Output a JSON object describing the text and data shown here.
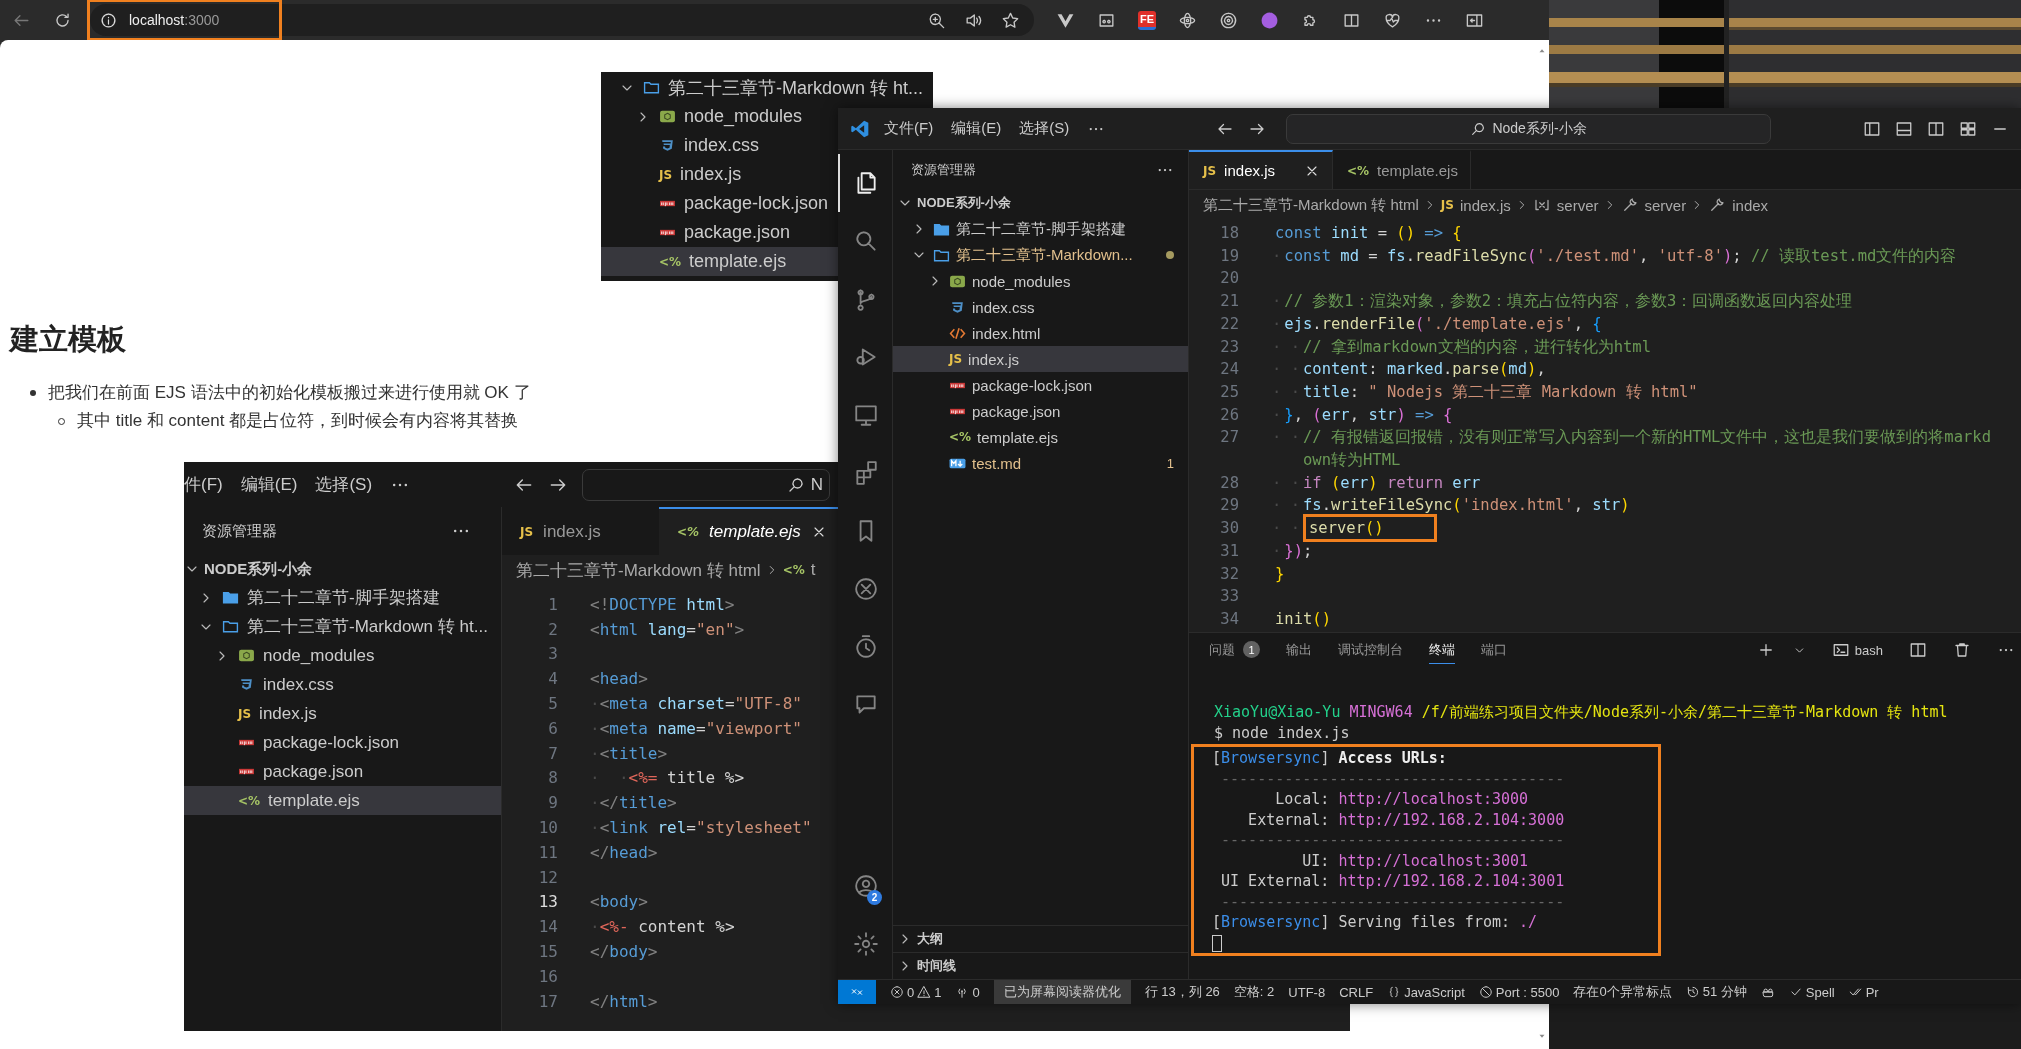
{
  "browser": {
    "address": {
      "host": "localhost",
      "port": ":3000",
      "highlighted": true
    },
    "fe_badge": "FE"
  },
  "page": {
    "explorer_shot": {
      "tree": [
        {
          "label": "第二十三章节-Markdown 转 ht...",
          "kind": "folder",
          "expanded": true,
          "selected": false,
          "children": [
            {
              "label": "node_modules",
              "kind": "node_modules",
              "expanded": false,
              "selected": false
            },
            {
              "label": "index.css",
              "kind": "css",
              "selected": false
            },
            {
              "label": "index.js",
              "kind": "js",
              "icon_text": "JS",
              "selected": false
            },
            {
              "label": "package-lock.json",
              "kind": "npm",
              "selected": false
            },
            {
              "label": "package.json",
              "kind": "npm",
              "selected": false
            },
            {
              "label": "template.ejs",
              "kind": "ejs",
              "icon_text": "<%",
              "selected": true
            }
          ]
        }
      ]
    },
    "heading": "建立模板",
    "bullets": [
      {
        "text": "把我们在前面 EJS 语法中的初始化模板搬过来进行使用就 OK 了",
        "children": [
          {
            "text": "其中 title 和 content 都是占位符，到时候会有内容将其替换"
          }
        ]
      }
    ],
    "editor_shot": {
      "menus": [
        "件(F)",
        "编辑(E)",
        "选择(S)"
      ],
      "search_text": "N",
      "explorer_title": "资源管理器",
      "root": "NODE系列-小余",
      "tree": [
        {
          "label": "第二十二章节-脚手架搭建",
          "kind": "folder",
          "expanded": false,
          "selected": false
        },
        {
          "label": "第二十三章节-Markdown 转 ht...",
          "kind": "folder",
          "expanded": true,
          "selected": false,
          "children": [
            {
              "label": "node_modules",
              "kind": "node_modules",
              "expanded": false,
              "selected": false
            },
            {
              "label": "index.css",
              "kind": "css",
              "selected": false
            },
            {
              "label": "index.js",
              "kind": "js",
              "icon_text": "JS",
              "selected": false
            },
            {
              "label": "package-lock.json",
              "kind": "npm",
              "selected": false
            },
            {
              "label": "package.json",
              "kind": "npm",
              "selected": false
            },
            {
              "label": "template.ejs",
              "kind": "ejs",
              "icon_text": "<%",
              "selected": true
            }
          ]
        }
      ],
      "tabs": [
        {
          "label": "index.js",
          "kind": "js",
          "icon_text": "JS",
          "selected": false,
          "preview": false
        },
        {
          "label": "template.ejs",
          "kind": "ejs",
          "icon_text": "<%",
          "selected": true,
          "preview": true
        }
      ],
      "breadcrumb": [
        {
          "label": "第二十三章节-Markdown 转 html",
          "kind": "plain"
        },
        {
          "label": "t",
          "kind": "ejs",
          "icon_text": "<%"
        }
      ],
      "lines": [
        {
          "n": "1",
          "current": false,
          "tokens": [
            {
              "kind": "tag",
              "text": "<!"
            },
            {
              "kind": "tagname",
              "text": "DOCTYPE "
            },
            {
              "kind": "attr",
              "text": "html"
            },
            {
              "kind": "tag",
              "text": ">"
            }
          ]
        },
        {
          "n": "2",
          "current": false,
          "tokens": [
            {
              "kind": "tag",
              "text": "<"
            },
            {
              "kind": "tagname",
              "text": "html "
            },
            {
              "kind": "attr",
              "text": "lang"
            },
            {
              "kind": "punct",
              "text": "="
            },
            {
              "kind": "string",
              "text": "\"en\""
            },
            {
              "kind": "tag",
              "text": ">"
            }
          ]
        },
        {
          "n": "3",
          "current": false
        },
        {
          "n": "4",
          "current": false,
          "tokens": [
            {
              "kind": "tag",
              "text": "<"
            },
            {
              "kind": "tagname",
              "text": "head"
            },
            {
              "kind": "tag",
              "text": ">"
            }
          ]
        },
        {
          "n": "5",
          "current": false,
          "indent": "·",
          "tokens": [
            {
              "kind": "tag",
              "text": "<"
            },
            {
              "kind": "tagname",
              "text": "meta "
            },
            {
              "kind": "attr",
              "text": "charset"
            },
            {
              "kind": "punct",
              "text": "="
            },
            {
              "kind": "string",
              "text": "\"UTF-8\""
            }
          ]
        },
        {
          "n": "6",
          "current": false,
          "indent": "·",
          "tokens": [
            {
              "kind": "tag",
              "text": "<"
            },
            {
              "kind": "tagname",
              "text": "meta "
            },
            {
              "kind": "attr",
              "text": "name"
            },
            {
              "kind": "punct",
              "text": "="
            },
            {
              "kind": "string",
              "text": "\"viewport\""
            }
          ]
        },
        {
          "n": "7",
          "current": false,
          "indent": "·",
          "tokens": [
            {
              "kind": "tag",
              "text": "<"
            },
            {
              "kind": "tagname",
              "text": "title"
            },
            {
              "kind": "tag",
              "text": ">"
            }
          ]
        },
        {
          "n": "8",
          "current": false,
          "indent": "·  ·",
          "tokens": [
            {
              "kind": "ejs",
              "text": "<%="
            },
            {
              "kind": "punct",
              "text": " title %>"
            }
          ]
        },
        {
          "n": "9",
          "current": false,
          "indent": "·",
          "tokens": [
            {
              "kind": "tag",
              "text": "</"
            },
            {
              "kind": "tagname",
              "text": "title"
            },
            {
              "kind": "tag",
              "text": ">"
            }
          ]
        },
        {
          "n": "10",
          "current": false,
          "indent": "·",
          "tokens": [
            {
              "kind": "tag",
              "text": "<"
            },
            {
              "kind": "tagname",
              "text": "link "
            },
            {
              "kind": "attr",
              "text": "rel"
            },
            {
              "kind": "punct",
              "text": "="
            },
            {
              "kind": "string",
              "text": "\"stylesheet\""
            }
          ]
        },
        {
          "n": "11",
          "current": false,
          "tokens": [
            {
              "kind": "tag",
              "text": "</"
            },
            {
              "kind": "tagname",
              "text": "head"
            },
            {
              "kind": "tag",
              "text": ">"
            }
          ]
        },
        {
          "n": "12",
          "current": false
        },
        {
          "n": "13",
          "current": true,
          "tokens": [
            {
              "kind": "tag",
              "text": "<"
            },
            {
              "kind": "tagname",
              "text": "body"
            },
            {
              "kind": "tag",
              "text": ">"
            }
          ]
        },
        {
          "n": "14",
          "current": false,
          "indent": "·",
          "tokens": [
            {
              "kind": "ejs",
              "text": "<%-"
            },
            {
              "kind": "punct",
              "text": " content %>"
            }
          ]
        },
        {
          "n": "15",
          "current": false,
          "tokens": [
            {
              "kind": "tag",
              "text": "</"
            },
            {
              "kind": "tagname",
              "text": "body"
            },
            {
              "kind": "tag",
              "text": ">"
            }
          ]
        },
        {
          "n": "16",
          "current": false
        },
        {
          "n": "17",
          "current": false,
          "tokens": [
            {
              "kind": "tag",
              "text": "</"
            },
            {
              "kind": "tagname",
              "text": "html"
            },
            {
              "kind": "tag",
              "text": ">"
            }
          ]
        }
      ]
    }
  },
  "vscode": {
    "menus": [
      "文件(F)",
      "编辑(E)",
      "选择(S)"
    ],
    "command_center": "Node系列-小余",
    "activity": [
      {
        "selected": true
      },
      {
        "selected": false
      },
      {
        "selected": false
      },
      {
        "selected": false
      },
      {
        "selected": false
      },
      {
        "selected": false
      },
      {
        "selected": false
      },
      {
        "selected": false
      },
      {
        "selected": false
      },
      {
        "selected": false
      }
    ],
    "account_badge": "2",
    "sidebar": {
      "title": "资源管理器",
      "root": "NODE系列-小余",
      "tree": [
        {
          "label": "第二十二章节-脚手架搭建",
          "kind": "folder",
          "expanded": false,
          "selected": false,
          "modified": false
        },
        {
          "label": "第二十三章节-Markdown...",
          "kind": "folder",
          "expanded": true,
          "selected": false,
          "modified": true,
          "children": [
            {
              "label": "node_modules",
              "kind": "node_modules",
              "expanded": false,
              "selected": false,
              "modified": false
            },
            {
              "label": "index.css",
              "kind": "css",
              "selected": false,
              "modified": false
            },
            {
              "label": "index.html",
              "kind": "html",
              "selected": false,
              "modified": false
            },
            {
              "label": "index.js",
              "kind": "js",
              "icon_text": "JS",
              "selected": true,
              "modified": false
            },
            {
              "label": "package-lock.json",
              "kind": "npm",
              "selected": false,
              "modified": false
            },
            {
              "label": "package.json",
              "kind": "npm",
              "selected": false,
              "modified": false
            },
            {
              "label": "template.ejs",
              "kind": "ejs",
              "icon_text": "<%",
              "selected": false,
              "modified": false
            },
            {
              "label": "test.md",
              "kind": "md",
              "selected": false,
              "modified": true,
              "badge": "1"
            }
          ]
        }
      ],
      "sections": [
        {
          "label": "大纲",
          "expanded": false
        },
        {
          "label": "时间线",
          "expanded": false
        }
      ]
    },
    "editor": {
      "tabs": [
        {
          "label": "index.js",
          "kind": "js",
          "icon_text": "JS",
          "selected": true
        },
        {
          "label": "template.ejs",
          "kind": "ejs",
          "icon_text": "<%",
          "selected": false
        }
      ],
      "breadcrumb": [
        {
          "label": "第二十三章节-Markdown 转 html",
          "kind": "plain"
        },
        {
          "label": "index.js",
          "kind": "js",
          "icon_text": "JS"
        },
        {
          "label": "server",
          "kind": "variable"
        },
        {
          "label": "server",
          "kind": "function"
        },
        {
          "label": "index",
          "kind": "function"
        }
      ],
      "lines": [
        {
          "n": "18",
          "highlighted": false,
          "tokens": [
            {
              "kind": "keyword",
              "text": "const "
            },
            {
              "kind": "variable",
              "text": "init"
            },
            {
              "kind": "punct",
              "text": " = "
            },
            {
              "kind": "brace",
              "text": "()"
            },
            {
              "kind": "keyword",
              "text": " => "
            },
            {
              "kind": "brace",
              "text": "{"
            }
          ]
        },
        {
          "n": "19",
          "highlighted": false,
          "indent": "·",
          "tokens": [
            {
              "kind": "keyword",
              "text": "const "
            },
            {
              "kind": "variable",
              "text": "md"
            },
            {
              "kind": "punct",
              "text": " = "
            },
            {
              "kind": "variable",
              "text": "fs"
            },
            {
              "kind": "punct",
              "text": "."
            },
            {
              "kind": "function",
              "text": "readFileSync"
            },
            {
              "kind": "paren",
              "text": "("
            },
            {
              "kind": "string",
              "text": "'./test.md'"
            },
            {
              "kind": "punct",
              "text": ", "
            },
            {
              "kind": "string",
              "text": "'utf-8'"
            },
            {
              "kind": "paren",
              "text": ")"
            },
            {
              "kind": "punct",
              "text": "; "
            },
            {
              "kind": "comment",
              "text": "// 读取test.md文件的内容"
            }
          ]
        },
        {
          "n": "20"
        },
        {
          "n": "21",
          "highlighted": false,
          "indent": "·",
          "tokens": [
            {
              "kind": "comment",
              "text": "// 参数1：渲染对象，参数2：填充占位符内容，参数3：回调函数返回内容处理"
            }
          ]
        },
        {
          "n": "22",
          "highlighted": false,
          "indent": "·",
          "tokens": [
            {
              "kind": "variable",
              "text": "ejs"
            },
            {
              "kind": "punct",
              "text": "."
            },
            {
              "kind": "function",
              "text": "renderFile"
            },
            {
              "kind": "paren",
              "text": "("
            },
            {
              "kind": "string",
              "text": "'./template.ejs'"
            },
            {
              "kind": "punct",
              "text": ", "
            },
            {
              "kind": "block",
              "text": "{"
            }
          ]
        },
        {
          "n": "23",
          "highlighted": false,
          "indent": "· ·",
          "tokens": [
            {
              "kind": "comment",
              "text": "// 拿到markdown文档的内容，进行转化为html"
            }
          ]
        },
        {
          "n": "24",
          "highlighted": false,
          "indent": "· ·",
          "tokens": [
            {
              "kind": "variable",
              "text": "content"
            },
            {
              "kind": "punct",
              "text": ": "
            },
            {
              "kind": "variable",
              "text": "marked"
            },
            {
              "kind": "punct",
              "text": "."
            },
            {
              "kind": "function",
              "text": "parse"
            },
            {
              "kind": "brace",
              "text": "("
            },
            {
              "kind": "variable",
              "text": "md"
            },
            {
              "kind": "brace",
              "text": ")"
            },
            {
              "kind": "punct",
              "text": ","
            }
          ]
        },
        {
          "n": "25",
          "highlighted": false,
          "indent": "· ·",
          "tokens": [
            {
              "kind": "variable",
              "text": "title"
            },
            {
              "kind": "punct",
              "text": ": "
            },
            {
              "kind": "string",
              "text": "\" Nodejs 第二十三章 Markdown 转 html\""
            }
          ]
        },
        {
          "n": "26",
          "highlighted": false,
          "indent": "·",
          "tokens": [
            {
              "kind": "block",
              "text": "}"
            },
            {
              "kind": "punct",
              "text": ", "
            },
            {
              "kind": "paren",
              "text": "("
            },
            {
              "kind": "variable",
              "text": "err"
            },
            {
              "kind": "punct",
              "text": ", "
            },
            {
              "kind": "variable",
              "text": "str"
            },
            {
              "kind": "paren",
              "text": ")"
            },
            {
              "kind": "keyword",
              "text": " => "
            },
            {
              "kind": "paren",
              "text": "{"
            }
          ]
        },
        {
          "n": "27",
          "highlighted": false,
          "indent": "· ·",
          "tokens": [
            {
              "kind": "comment",
              "text": "// 有报错返回报错，没有则正常写入内容到一个新的HTML文件中，这也是我们要做到的将markdown转为HTML"
            }
          ]
        },
        {
          "n": "28",
          "highlighted": false,
          "indent": "· ·",
          "tokens": [
            {
              "kind": "control",
              "text": "if "
            },
            {
              "kind": "brace",
              "text": "("
            },
            {
              "kind": "variable",
              "text": "err"
            },
            {
              "kind": "brace",
              "text": ")"
            },
            {
              "kind": "control",
              "text": " return "
            },
            {
              "kind": "variable",
              "text": "err"
            }
          ]
        },
        {
          "n": "29",
          "highlighted": false,
          "indent": "· ·",
          "tokens": [
            {
              "kind": "variable",
              "text": "fs"
            },
            {
              "kind": "punct",
              "text": "."
            },
            {
              "kind": "function",
              "text": "writeFileSync"
            },
            {
              "kind": "brace",
              "text": "("
            },
            {
              "kind": "string",
              "text": "'index.html'"
            },
            {
              "kind": "punct",
              "text": ", "
            },
            {
              "kind": "variable",
              "text": "str"
            },
            {
              "kind": "brace",
              "text": ")"
            }
          ]
        },
        {
          "n": "30",
          "highlighted": true,
          "indent": "· ·",
          "tokens": [
            {
              "kind": "function",
              "text": "server"
            },
            {
              "kind": "brace",
              "text": "()"
            }
          ]
        },
        {
          "n": "31",
          "highlighted": false,
          "indent": "·",
          "tokens": [
            {
              "kind": "paren",
              "text": "})"
            },
            {
              "kind": "punct",
              "text": ";"
            }
          ]
        },
        {
          "n": "32",
          "highlighted": false,
          "tokens": [
            {
              "kind": "brace",
              "text": "}"
            }
          ]
        },
        {
          "n": "33"
        },
        {
          "n": "34",
          "tokens": [
            {
              "kind": "function",
              "text": "init"
            },
            {
              "kind": "brace",
              "text": "()"
            }
          ]
        }
      ]
    },
    "panel": {
      "tabs": [
        {
          "label": "问题",
          "badge": "1",
          "selected": false
        },
        {
          "label": "输出",
          "selected": false
        },
        {
          "label": "调试控制台",
          "selected": false
        },
        {
          "label": "终端",
          "selected": true
        },
        {
          "label": "端口",
          "selected": false
        }
      ],
      "shell": "bash"
    },
    "terminal": {
      "lines": [
        [
          {
            "kind": "user",
            "text": "XiaoYu@Xiao-Yu "
          },
          {
            "kind": "system",
            "text": "MINGW64 "
          },
          {
            "kind": "path",
            "text": "/f/前端练习项目文件夹/Node系列-小余/第二十三章节-Markdown 转 html"
          }
        ],
        [
          {
            "kind": "plain",
            "text": "$ node index.js"
          }
        ]
      ],
      "output": {
        "highlighted": true,
        "lines": [
          [
            {
              "kind": "plain",
              "text": "["
            },
            {
              "kind": "label",
              "text": "Browsersync"
            },
            {
              "kind": "plain",
              "text": "] "
            },
            {
              "kind": "bold",
              "text": "Access URLs:"
            }
          ],
          [
            {
              "kind": "rule",
              "text": " --------------------------------------"
            }
          ],
          [
            {
              "kind": "plain",
              "text": "       Local: "
            },
            {
              "kind": "link",
              "text": "http://localhost:3000"
            }
          ],
          [
            {
              "kind": "plain",
              "text": "    External: "
            },
            {
              "kind": "link",
              "text": "http://192.168.2.104:3000"
            }
          ],
          [
            {
              "kind": "rule",
              "text": " --------------------------------------"
            }
          ],
          [
            {
              "kind": "plain",
              "text": "          UI: "
            },
            {
              "kind": "link",
              "text": "http://localhost:3001"
            }
          ],
          [
            {
              "kind": "plain",
              "text": " UI External: "
            },
            {
              "kind": "link",
              "text": "http://192.168.2.104:3001"
            }
          ],
          [
            {
              "kind": "rule",
              "text": " --------------------------------------"
            }
          ],
          [
            {
              "kind": "plain",
              "text": "["
            },
            {
              "kind": "label",
              "text": "Browsersync"
            },
            {
              "kind": "plain",
              "text": "] Serving files from: "
            },
            {
              "kind": "link",
              "text": "./"
            }
          ]
        ]
      }
    },
    "status_bar": [
      {
        "kind": "remote"
      },
      {
        "kind": "problems",
        "errors": "0",
        "warnings": "1"
      },
      {
        "kind": "ports",
        "text": "0"
      },
      {
        "kind": "badge",
        "text": "已为屏幕阅读器优化"
      },
      {
        "kind": "text",
        "text": "行 13，列 26"
      },
      {
        "kind": "text",
        "text": "空格: 2"
      },
      {
        "kind": "text",
        "text": "UTF-8"
      },
      {
        "kind": "text",
        "text": "CRLF"
      },
      {
        "kind": "language",
        "text": "JavaScript"
      },
      {
        "kind": "port",
        "text": "Port : 5500"
      },
      {
        "kind": "text",
        "text": "存在0个异常标点"
      },
      {
        "kind": "timer",
        "text": "51 分钟"
      },
      {
        "kind": "copilot"
      },
      {
        "kind": "spell",
        "text": "Spell"
      },
      {
        "kind": "prettier",
        "text": "Pr"
      }
    ]
  }
}
